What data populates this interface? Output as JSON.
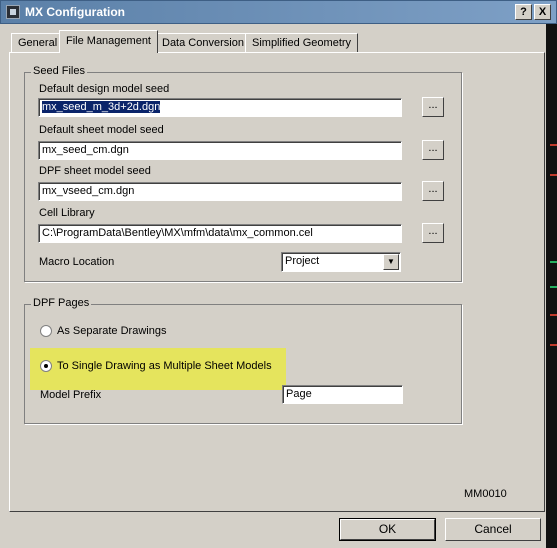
{
  "window": {
    "title": "MX Configuration",
    "help_label": "?",
    "close_label": "X"
  },
  "tabs": [
    {
      "label": "General"
    },
    {
      "label": "File Management"
    },
    {
      "label": "Data Conversion"
    },
    {
      "label": "Simplified Geometry"
    }
  ],
  "seed_files": {
    "legend": "Seed Files",
    "design_label": "Default design model seed",
    "design_value": "mx_seed_m_3d+2d.dgn",
    "sheet_label": "Default sheet model seed",
    "sheet_value": "mx_seed_cm.dgn",
    "dpf_label": "DPF sheet model seed",
    "dpf_value": "mx_vseed_cm.dgn",
    "cell_label": "Cell Library",
    "cell_value": "C:\\ProgramData\\Bentley\\MX\\mfm\\data\\mx_common.cel",
    "browse_label": "...",
    "macro_label": "Macro Location",
    "macro_value": "Project"
  },
  "dpf_pages": {
    "legend": "DPF Pages",
    "option_separate": "As Separate Drawings",
    "option_single": "To Single Drawing as Multiple Sheet Models",
    "prefix_label": "Model Prefix",
    "prefix_value": "Page"
  },
  "footer": {
    "code": "MM0010",
    "ok_label": "OK",
    "cancel_label": "Cancel"
  },
  "colors": {
    "highlight": "#e8e84a",
    "selection": "#0a246a",
    "titlebar": "#6a8fb8"
  }
}
